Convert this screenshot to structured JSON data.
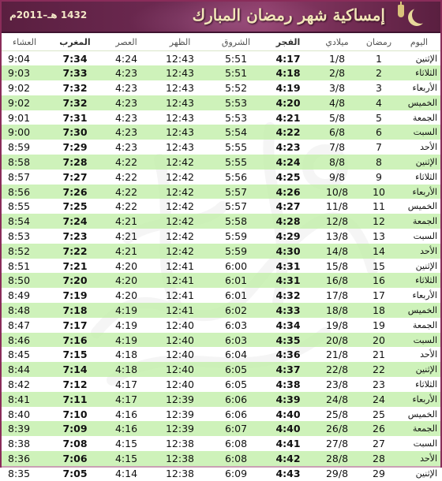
{
  "header": {
    "title": "إمساكية شهر رمضان المبارك",
    "year": "1432 هـ–2011م"
  },
  "columns": {
    "isha": "العشاء",
    "maghrib": "المغرب",
    "asr": "العصر",
    "dhuhr": "الظهر",
    "shuruq": "الشروق",
    "fajr": "الفجر",
    "milady": "ميلادي",
    "ramadan": "رمضان",
    "day": "اليوم"
  },
  "rows": [
    {
      "isha": "9:04",
      "maghrib": "7:34",
      "asr": "4:24",
      "dhuhr": "12:43",
      "shuruq": "5:51",
      "fajr": "4:17",
      "date": "1/8",
      "ramadan": "1",
      "day": "الإثنين"
    },
    {
      "isha": "9:03",
      "maghrib": "7:33",
      "asr": "4:23",
      "dhuhr": "12:43",
      "shuruq": "5:51",
      "fajr": "4:18",
      "date": "2/8",
      "ramadan": "2",
      "day": "الثلاثاء"
    },
    {
      "isha": "9:02",
      "maghrib": "7:32",
      "asr": "4:23",
      "dhuhr": "12:43",
      "shuruq": "5:52",
      "fajr": "4:19",
      "date": "3/8",
      "ramadan": "3",
      "day": "الأربعاء"
    },
    {
      "isha": "9:02",
      "maghrib": "7:32",
      "asr": "4:23",
      "dhuhr": "12:43",
      "shuruq": "5:53",
      "fajr": "4:20",
      "date": "4/8",
      "ramadan": "4",
      "day": "الخميس"
    },
    {
      "isha": "9:01",
      "maghrib": "7:31",
      "asr": "4:23",
      "dhuhr": "12:43",
      "shuruq": "5:53",
      "fajr": "4:21",
      "date": "5/8",
      "ramadan": "5",
      "day": "الجمعة"
    },
    {
      "isha": "9:00",
      "maghrib": "7:30",
      "asr": "4:23",
      "dhuhr": "12:43",
      "shuruq": "5:54",
      "fajr": "4:22",
      "date": "6/8",
      "ramadan": "6",
      "day": "السبت"
    },
    {
      "isha": "8:59",
      "maghrib": "7:29",
      "asr": "4:23",
      "dhuhr": "12:43",
      "shuruq": "5:55",
      "fajr": "4:23",
      "date": "7/8",
      "ramadan": "7",
      "day": "الأحد"
    },
    {
      "isha": "8:58",
      "maghrib": "7:28",
      "asr": "4:22",
      "dhuhr": "12:42",
      "shuruq": "5:55",
      "fajr": "4:24",
      "date": "8/8",
      "ramadan": "8",
      "day": "الإثنين"
    },
    {
      "isha": "8:57",
      "maghrib": "7:27",
      "asr": "4:22",
      "dhuhr": "12:42",
      "shuruq": "5:56",
      "fajr": "4:25",
      "date": "9/8",
      "ramadan": "9",
      "day": "الثلاثاء"
    },
    {
      "isha": "8:56",
      "maghrib": "7:26",
      "asr": "4:22",
      "dhuhr": "12:42",
      "shuruq": "5:57",
      "fajr": "4:26",
      "date": "10/8",
      "ramadan": "10",
      "day": "الأربعاء"
    },
    {
      "isha": "8:55",
      "maghrib": "7:25",
      "asr": "4:22",
      "dhuhr": "12:42",
      "shuruq": "5:57",
      "fajr": "4:27",
      "date": "11/8",
      "ramadan": "11",
      "day": "الخميس"
    },
    {
      "isha": "8:54",
      "maghrib": "7:24",
      "asr": "4:21",
      "dhuhr": "12:42",
      "shuruq": "5:58",
      "fajr": "4:28",
      "date": "12/8",
      "ramadan": "12",
      "day": "الجمعة"
    },
    {
      "isha": "8:53",
      "maghrib": "7:23",
      "asr": "4:21",
      "dhuhr": "12:42",
      "shuruq": "5:59",
      "fajr": "4:29",
      "date": "13/8",
      "ramadan": "13",
      "day": "السبت"
    },
    {
      "isha": "8:52",
      "maghrib": "7:22",
      "asr": "4:21",
      "dhuhr": "12:42",
      "shuruq": "5:59",
      "fajr": "4:30",
      "date": "14/8",
      "ramadan": "14",
      "day": "الأحد"
    },
    {
      "isha": "8:51",
      "maghrib": "7:21",
      "asr": "4:20",
      "dhuhr": "12:41",
      "shuruq": "6:00",
      "fajr": "4:31",
      "date": "15/8",
      "ramadan": "15",
      "day": "الإثنين"
    },
    {
      "isha": "8:50",
      "maghrib": "7:20",
      "asr": "4:20",
      "dhuhr": "12:41",
      "shuruq": "6:01",
      "fajr": "4:31",
      "date": "16/8",
      "ramadan": "16",
      "day": "الثلاثاء"
    },
    {
      "isha": "8:49",
      "maghrib": "7:19",
      "asr": "4:20",
      "dhuhr": "12:41",
      "shuruq": "6:01",
      "fajr": "4:32",
      "date": "17/8",
      "ramadan": "17",
      "day": "الأربعاء"
    },
    {
      "isha": "8:48",
      "maghrib": "7:18",
      "asr": "4:19",
      "dhuhr": "12:41",
      "shuruq": "6:02",
      "fajr": "4:33",
      "date": "18/8",
      "ramadan": "18",
      "day": "الخميس"
    },
    {
      "isha": "8:47",
      "maghrib": "7:17",
      "asr": "4:19",
      "dhuhr": "12:40",
      "shuruq": "6:03",
      "fajr": "4:34",
      "date": "19/8",
      "ramadan": "19",
      "day": "الجمعة"
    },
    {
      "isha": "8:46",
      "maghrib": "7:16",
      "asr": "4:19",
      "dhuhr": "12:40",
      "shuruq": "6:03",
      "fajr": "4:35",
      "date": "20/8",
      "ramadan": "20",
      "day": "السبت"
    },
    {
      "isha": "8:45",
      "maghrib": "7:15",
      "asr": "4:18",
      "dhuhr": "12:40",
      "shuruq": "6:04",
      "fajr": "4:36",
      "date": "21/8",
      "ramadan": "21",
      "day": "الأحد"
    },
    {
      "isha": "8:44",
      "maghrib": "7:14",
      "asr": "4:18",
      "dhuhr": "12:40",
      "shuruq": "6:05",
      "fajr": "4:37",
      "date": "22/8",
      "ramadan": "22",
      "day": "الإثنين"
    },
    {
      "isha": "8:42",
      "maghrib": "7:12",
      "asr": "4:17",
      "dhuhr": "12:40",
      "shuruq": "6:05",
      "fajr": "4:38",
      "date": "23/8",
      "ramadan": "23",
      "day": "الثلاثاء"
    },
    {
      "isha": "8:41",
      "maghrib": "7:11",
      "asr": "4:17",
      "dhuhr": "12:39",
      "shuruq": "6:06",
      "fajr": "4:39",
      "date": "24/8",
      "ramadan": "24",
      "day": "الأربعاء"
    },
    {
      "isha": "8:40",
      "maghrib": "7:10",
      "asr": "4:16",
      "dhuhr": "12:39",
      "shuruq": "6:06",
      "fajr": "4:40",
      "date": "25/8",
      "ramadan": "25",
      "day": "الخميس"
    },
    {
      "isha": "8:39",
      "maghrib": "7:09",
      "asr": "4:16",
      "dhuhr": "12:39",
      "shuruq": "6:07",
      "fajr": "4:40",
      "date": "26/8",
      "ramadan": "26",
      "day": "الجمعة"
    },
    {
      "isha": "8:38",
      "maghrib": "7:08",
      "asr": "4:15",
      "dhuhr": "12:38",
      "shuruq": "6:08",
      "fajr": "4:41",
      "date": "27/8",
      "ramadan": "27",
      "day": "السبت"
    },
    {
      "isha": "8:36",
      "maghrib": "7:06",
      "asr": "4:15",
      "dhuhr": "12:38",
      "shuruq": "6:08",
      "fajr": "4:42",
      "date": "28/8",
      "ramadan": "28",
      "day": "الأحد"
    },
    {
      "isha": "8:35",
      "maghrib": "7:05",
      "asr": "4:14",
      "dhuhr": "12:38",
      "shuruq": "6:09",
      "fajr": "4:43",
      "date": "29/8",
      "ramadan": "29",
      "day": "الإثنين"
    }
  ]
}
